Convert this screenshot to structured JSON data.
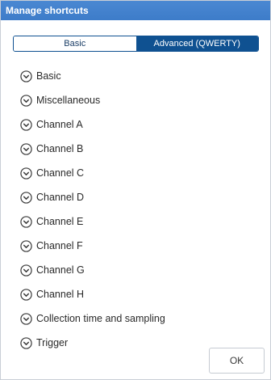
{
  "dialog": {
    "title": "Manage shortcuts"
  },
  "tabs": [
    {
      "label": "Basic",
      "selected": false
    },
    {
      "label": "Advanced (QWERTY)",
      "selected": true
    }
  ],
  "sections": [
    {
      "label": "Basic",
      "icon": "chevron-down-circle-icon"
    },
    {
      "label": "Miscellaneous",
      "icon": "chevron-down-circle-icon"
    },
    {
      "label": "Channel A",
      "icon": "chevron-down-circle-icon"
    },
    {
      "label": "Channel B",
      "icon": "chevron-down-circle-icon"
    },
    {
      "label": "Channel C",
      "icon": "chevron-down-circle-icon"
    },
    {
      "label": "Channel D",
      "icon": "chevron-down-circle-icon"
    },
    {
      "label": "Channel E",
      "icon": "chevron-down-circle-icon"
    },
    {
      "label": "Channel F",
      "icon": "chevron-down-circle-icon"
    },
    {
      "label": "Channel G",
      "icon": "chevron-down-circle-icon"
    },
    {
      "label": "Channel H",
      "icon": "chevron-down-circle-icon"
    },
    {
      "label": "Collection time and sampling",
      "icon": "chevron-down-circle-icon"
    },
    {
      "label": "Trigger",
      "icon": "chevron-down-circle-icon"
    }
  ],
  "footer": {
    "ok_label": "OK"
  },
  "colors": {
    "titlebar": "#3d7cc9",
    "segment_active": "#0f5191"
  }
}
